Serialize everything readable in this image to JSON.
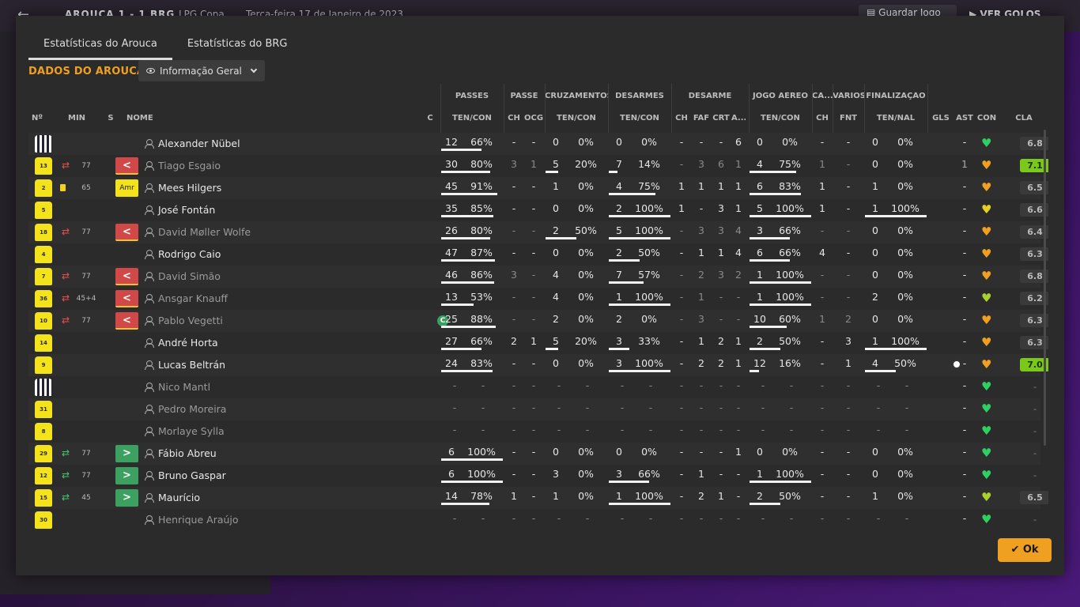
{
  "background": {
    "match_score": "AROUCA  1 - 1  BRG",
    "competition": "LPG Copa",
    "date": "Terça-feira 17 de Janeiro de 2023",
    "save_button": "Guardar Jogo",
    "goals_button": "VER GOLOS"
  },
  "modal": {
    "tabs": [
      "Estatísticas do Arouca",
      "Estatísticas do BRG"
    ],
    "section_title": "DADOS DO AROUCA",
    "view_selector": "Informação Geral",
    "ok_button": "Ok"
  },
  "groups": [
    "PASSES",
    "PASSE",
    "CRUZAMENTOS",
    "DESARMES",
    "DESARME",
    "JOGO AÉREO",
    "CA...",
    "VÁRIOS",
    "FINALIZAÇÃO"
  ],
  "headers": [
    "Nº",
    "MIN",
    "S",
    "NOME",
    "C",
    "TEN/CON",
    "CH",
    "OCG",
    "TEN/CON",
    "TEN/CON",
    "CH",
    "FAF",
    "CRT",
    "A...",
    "TEN/CON",
    "CH",
    "FNT",
    "TEN/NAL",
    "GLS",
    "AST",
    "CON",
    "CLA"
  ],
  "players": [
    {
      "num": "",
      "kit": "stripe",
      "card": "",
      "sub": "",
      "min": "",
      "s": "",
      "s_kind": "",
      "name": "Alexander Nübel",
      "dim": false,
      "capt": false,
      "pass_ten": "12",
      "pass_pct": "66%",
      "pass_ch": "-",
      "pass_ocg": "-",
      "cruz_ten": "0",
      "cruz_pct": "0%",
      "des_ten": "0",
      "des_pct": "0%",
      "d_ch": "-",
      "d_faf": "-",
      "d_crt": "-",
      "d_a": "6",
      "aer_ten": "0",
      "aer_pct": "0%",
      "ca_ch": "-",
      "fnt": "-",
      "fin_ten": "0",
      "fin_pct": "0%",
      "gls": "",
      "ast": "-",
      "con": "green",
      "cla": "6.8",
      "cla_kind": "normal",
      "bars": {
        "pass": 0.66,
        "cruz": 0,
        "des": 0,
        "aer": 0,
        "fin": 0
      }
    },
    {
      "num": "13",
      "kit": "yellow",
      "card": "",
      "sub": "out",
      "min": "77",
      "s": "<",
      "s_kind": "out",
      "name": "Tiago Esgaio",
      "dim": true,
      "capt": false,
      "pass_ten": "30",
      "pass_pct": "80%",
      "pass_ch": "3",
      "pass_ocg": "1",
      "cruz_ten": "5",
      "cruz_pct": "20%",
      "des_ten": "7",
      "des_pct": "14%",
      "d_ch": "-",
      "d_faf": "3",
      "d_crt": "6",
      "d_a": "1",
      "aer_ten": "4",
      "aer_pct": "75%",
      "ca_ch": "1",
      "fnt": "-",
      "fin_ten": "0",
      "fin_pct": "0%",
      "gls": "",
      "ast": "1",
      "con": "orange",
      "cla": "7.1",
      "cla_kind": "green",
      "bars": {
        "pass": 0.8,
        "cruz": 0.2,
        "des": 0.14,
        "aer": 0.75,
        "fin": 0
      }
    },
    {
      "num": "2",
      "kit": "yellow",
      "card": "yellow",
      "sub": "",
      "min": "65",
      "s": "Amr",
      "s_kind": "amr",
      "name": "Mees Hilgers",
      "dim": false,
      "capt": false,
      "pass_ten": "45",
      "pass_pct": "91%",
      "pass_ch": "-",
      "pass_ocg": "-",
      "cruz_ten": "1",
      "cruz_pct": "0%",
      "des_ten": "4",
      "des_pct": "75%",
      "d_ch": "1",
      "d_faf": "1",
      "d_crt": "1",
      "d_a": "1",
      "aer_ten": "6",
      "aer_pct": "83%",
      "ca_ch": "1",
      "fnt": "-",
      "fin_ten": "1",
      "fin_pct": "0%",
      "gls": "",
      "ast": "-",
      "con": "orange",
      "cla": "6.5",
      "cla_kind": "normal",
      "bars": {
        "pass": 0.91,
        "cruz": 0,
        "des": 0.75,
        "aer": 0.83,
        "fin": 0
      }
    },
    {
      "num": "5",
      "kit": "yellow",
      "card": "",
      "sub": "",
      "min": "",
      "s": "",
      "s_kind": "",
      "name": "José Fontán",
      "dim": false,
      "capt": false,
      "pass_ten": "35",
      "pass_pct": "85%",
      "pass_ch": "-",
      "pass_ocg": "-",
      "cruz_ten": "0",
      "cruz_pct": "0%",
      "des_ten": "2",
      "des_pct": "100%",
      "d_ch": "1",
      "d_faf": "-",
      "d_crt": "3",
      "d_a": "1",
      "aer_ten": "5",
      "aer_pct": "100%",
      "ca_ch": "1",
      "fnt": "-",
      "fin_ten": "1",
      "fin_pct": "100%",
      "gls": "",
      "ast": "-",
      "con": "yellow",
      "cla": "6.6",
      "cla_kind": "normal",
      "bars": {
        "pass": 0.85,
        "cruz": 0,
        "des": 1,
        "aer": 1,
        "fin": 1
      }
    },
    {
      "num": "18",
      "kit": "yellow",
      "card": "",
      "sub": "out",
      "min": "77",
      "s": "<",
      "s_kind": "out",
      "name": "David Møller Wolfe",
      "dim": true,
      "capt": false,
      "pass_ten": "26",
      "pass_pct": "80%",
      "pass_ch": "-",
      "pass_ocg": "-",
      "cruz_ten": "2",
      "cruz_pct": "50%",
      "des_ten": "5",
      "des_pct": "100%",
      "d_ch": "-",
      "d_faf": "3",
      "d_crt": "3",
      "d_a": "4",
      "aer_ten": "3",
      "aer_pct": "66%",
      "ca_ch": "-",
      "fnt": "-",
      "fin_ten": "0",
      "fin_pct": "0%",
      "gls": "",
      "ast": "-",
      "con": "orange",
      "cla": "6.4",
      "cla_kind": "normal",
      "bars": {
        "pass": 0.8,
        "cruz": 0.5,
        "des": 1,
        "aer": 0.66,
        "fin": 0
      }
    },
    {
      "num": "4",
      "kit": "yellow",
      "card": "",
      "sub": "",
      "min": "",
      "s": "",
      "s_kind": "",
      "name": "Rodrigo Caio",
      "dim": false,
      "capt": false,
      "pass_ten": "47",
      "pass_pct": "87%",
      "pass_ch": "-",
      "pass_ocg": "-",
      "cruz_ten": "0",
      "cruz_pct": "0%",
      "des_ten": "2",
      "des_pct": "50%",
      "d_ch": "-",
      "d_faf": "1",
      "d_crt": "1",
      "d_a": "4",
      "aer_ten": "6",
      "aer_pct": "66%",
      "ca_ch": "4",
      "fnt": "-",
      "fin_ten": "0",
      "fin_pct": "0%",
      "gls": "",
      "ast": "-",
      "con": "orange",
      "cla": "6.3",
      "cla_kind": "normal",
      "bars": {
        "pass": 0.87,
        "cruz": 0,
        "des": 0.5,
        "aer": 0.66,
        "fin": 0
      }
    },
    {
      "num": "7",
      "kit": "yellow",
      "card": "",
      "sub": "out",
      "min": "77",
      "s": "<",
      "s_kind": "out",
      "name": "David Simão",
      "dim": true,
      "capt": false,
      "pass_ten": "46",
      "pass_pct": "86%",
      "pass_ch": "3",
      "pass_ocg": "-",
      "cruz_ten": "4",
      "cruz_pct": "0%",
      "des_ten": "7",
      "des_pct": "57%",
      "d_ch": "-",
      "d_faf": "2",
      "d_crt": "3",
      "d_a": "2",
      "aer_ten": "1",
      "aer_pct": "100%",
      "ca_ch": "-",
      "fnt": "-",
      "fin_ten": "0",
      "fin_pct": "0%",
      "gls": "",
      "ast": "-",
      "con": "orange",
      "cla": "6.8",
      "cla_kind": "normal",
      "bars": {
        "pass": 0.86,
        "cruz": 0,
        "des": 0.57,
        "aer": 1,
        "fin": 0
      }
    },
    {
      "num": "36",
      "kit": "yellow",
      "card": "",
      "sub": "out",
      "min": "45+4",
      "s": "<",
      "s_kind": "out",
      "name": "Ansgar Knauff",
      "dim": true,
      "capt": false,
      "pass_ten": "13",
      "pass_pct": "53%",
      "pass_ch": "-",
      "pass_ocg": "-",
      "cruz_ten": "4",
      "cruz_pct": "0%",
      "des_ten": "1",
      "des_pct": "100%",
      "d_ch": "-",
      "d_faf": "1",
      "d_crt": "-",
      "d_a": "-",
      "aer_ten": "1",
      "aer_pct": "100%",
      "ca_ch": "-",
      "fnt": "-",
      "fin_ten": "2",
      "fin_pct": "0%",
      "gls": "",
      "ast": "-",
      "con": "green-yellow",
      "cla": "6.2",
      "cla_kind": "normal",
      "bars": {
        "pass": 0.53,
        "cruz": 0,
        "des": 1,
        "aer": 1,
        "fin": 0
      }
    },
    {
      "num": "10",
      "kit": "yellow",
      "card": "",
      "sub": "out",
      "min": "77",
      "s": "<",
      "s_kind": "out",
      "name": "Pablo Vegetti",
      "dim": true,
      "capt": true,
      "pass_ten": "25",
      "pass_pct": "88%",
      "pass_ch": "-",
      "pass_ocg": "-",
      "cruz_ten": "2",
      "cruz_pct": "0%",
      "des_ten": "2",
      "des_pct": "0%",
      "d_ch": "-",
      "d_faf": "3",
      "d_crt": "-",
      "d_a": "-",
      "aer_ten": "10",
      "aer_pct": "60%",
      "ca_ch": "1",
      "fnt": "2",
      "fin_ten": "0",
      "fin_pct": "0%",
      "gls": "",
      "ast": "-",
      "con": "orange",
      "cla": "6.3",
      "cla_kind": "normal",
      "bars": {
        "pass": 0.88,
        "cruz": 0,
        "des": 0,
        "aer": 0.6,
        "fin": 0
      }
    },
    {
      "num": "14",
      "kit": "yellow",
      "card": "",
      "sub": "",
      "min": "",
      "s": "",
      "s_kind": "",
      "name": "André Horta",
      "dim": false,
      "capt": false,
      "pass_ten": "27",
      "pass_pct": "66%",
      "pass_ch": "2",
      "pass_ocg": "1",
      "cruz_ten": "5",
      "cruz_pct": "20%",
      "des_ten": "3",
      "des_pct": "33%",
      "d_ch": "-",
      "d_faf": "1",
      "d_crt": "2",
      "d_a": "1",
      "aer_ten": "2",
      "aer_pct": "50%",
      "ca_ch": "-",
      "fnt": "3",
      "fin_ten": "1",
      "fin_pct": "100%",
      "gls": "",
      "ast": "-",
      "con": "orange",
      "cla": "6.3",
      "cla_kind": "normal",
      "bars": {
        "pass": 0.66,
        "cruz": 0.2,
        "des": 0.33,
        "aer": 0.5,
        "fin": 1
      }
    },
    {
      "num": "9",
      "kit": "yellow",
      "card": "",
      "sub": "",
      "min": "",
      "s": "",
      "s_kind": "",
      "name": "Lucas Beltrán",
      "dim": false,
      "capt": false,
      "pass_ten": "24",
      "pass_pct": "83%",
      "pass_ch": "-",
      "pass_ocg": "-",
      "cruz_ten": "0",
      "cruz_pct": "0%",
      "des_ten": "3",
      "des_pct": "100%",
      "d_ch": "-",
      "d_faf": "2",
      "d_crt": "2",
      "d_a": "1",
      "aer_ten": "12",
      "aer_pct": "16%",
      "ca_ch": "-",
      "fnt": "1",
      "fin_ten": "4",
      "fin_pct": "50%",
      "gls": "ball",
      "ast": "-",
      "con": "orange",
      "cla": "7.0",
      "cla_kind": "green",
      "bars": {
        "pass": 0.83,
        "cruz": 0,
        "des": 1,
        "aer": 0.16,
        "fin": 0.5
      }
    },
    {
      "num": "",
      "kit": "stripe",
      "card": "",
      "sub": "",
      "min": "",
      "s": "",
      "s_kind": "",
      "name": "Nico Mantl",
      "dim": true,
      "capt": false,
      "unused": true,
      "con": "green",
      "cla": "-",
      "cla_kind": "none"
    },
    {
      "num": "31",
      "kit": "yellow",
      "card": "",
      "sub": "",
      "min": "",
      "s": "",
      "s_kind": "",
      "name": "Pedro Moreira",
      "dim": true,
      "capt": false,
      "unused": true,
      "con": "green",
      "cla": "-",
      "cla_kind": "none"
    },
    {
      "num": "8",
      "kit": "yellow",
      "card": "",
      "sub": "",
      "min": "",
      "s": "",
      "s_kind": "",
      "name": "Morlaye Sylla",
      "dim": true,
      "capt": false,
      "unused": true,
      "con": "green",
      "cla": "-",
      "cla_kind": "none"
    },
    {
      "num": "29",
      "kit": "yellow",
      "card": "",
      "sub": "in",
      "min": "77",
      "s": ">",
      "s_kind": "in",
      "name": "Fábio Abreu",
      "dim": false,
      "capt": false,
      "pass_ten": "6",
      "pass_pct": "100%",
      "pass_ch": "-",
      "pass_ocg": "-",
      "cruz_ten": "0",
      "cruz_pct": "0%",
      "des_ten": "0",
      "des_pct": "0%",
      "d_ch": "-",
      "d_faf": "-",
      "d_crt": "-",
      "d_a": "1",
      "aer_ten": "0",
      "aer_pct": "0%",
      "ca_ch": "-",
      "fnt": "-",
      "fin_ten": "0",
      "fin_pct": "0%",
      "gls": "",
      "ast": "-",
      "con": "green",
      "cla": "-",
      "cla_kind": "none",
      "bars": {
        "pass": 1,
        "cruz": 0,
        "des": 0,
        "aer": 0,
        "fin": 0
      }
    },
    {
      "num": "12",
      "kit": "yellow",
      "card": "",
      "sub": "in",
      "min": "77",
      "s": ">",
      "s_kind": "in",
      "name": "Bruno Gaspar",
      "dim": false,
      "capt": false,
      "pass_ten": "6",
      "pass_pct": "100%",
      "pass_ch": "-",
      "pass_ocg": "-",
      "cruz_ten": "3",
      "cruz_pct": "0%",
      "des_ten": "3",
      "des_pct": "66%",
      "d_ch": "-",
      "d_faf": "1",
      "d_crt": "-",
      "d_a": "-",
      "aer_ten": "1",
      "aer_pct": "100%",
      "ca_ch": "-",
      "fnt": "-",
      "fin_ten": "0",
      "fin_pct": "0%",
      "gls": "",
      "ast": "-",
      "con": "green",
      "cla": "-",
      "cla_kind": "none",
      "bars": {
        "pass": 1,
        "cruz": 0,
        "des": 0.66,
        "aer": 1,
        "fin": 0
      }
    },
    {
      "num": "15",
      "kit": "yellow",
      "card": "",
      "sub": "in",
      "min": "45",
      "s": ">",
      "s_kind": "in",
      "name": "Maurício",
      "dim": false,
      "capt": false,
      "pass_ten": "14",
      "pass_pct": "78%",
      "pass_ch": "1",
      "pass_ocg": "-",
      "cruz_ten": "1",
      "cruz_pct": "0%",
      "des_ten": "1",
      "des_pct": "100%",
      "d_ch": "-",
      "d_faf": "2",
      "d_crt": "1",
      "d_a": "-",
      "aer_ten": "2",
      "aer_pct": "50%",
      "ca_ch": "-",
      "fnt": "-",
      "fin_ten": "1",
      "fin_pct": "0%",
      "gls": "",
      "ast": "-",
      "con": "green-yellow",
      "cla": "6.5",
      "cla_kind": "normal",
      "bars": {
        "pass": 0.78,
        "cruz": 0,
        "des": 1,
        "aer": 0.5,
        "fin": 0
      }
    },
    {
      "num": "30",
      "kit": "yellow",
      "card": "",
      "sub": "",
      "min": "",
      "s": "",
      "s_kind": "",
      "name": "Henrique Araújo",
      "dim": true,
      "capt": false,
      "unused": true,
      "con": "green",
      "cla": "-",
      "cla_kind": "none"
    }
  ],
  "colors": {
    "accent": "#f0a020",
    "sub_out": "#d04848",
    "sub_in": "#3ca060",
    "rating_good": "#7ac81a"
  }
}
